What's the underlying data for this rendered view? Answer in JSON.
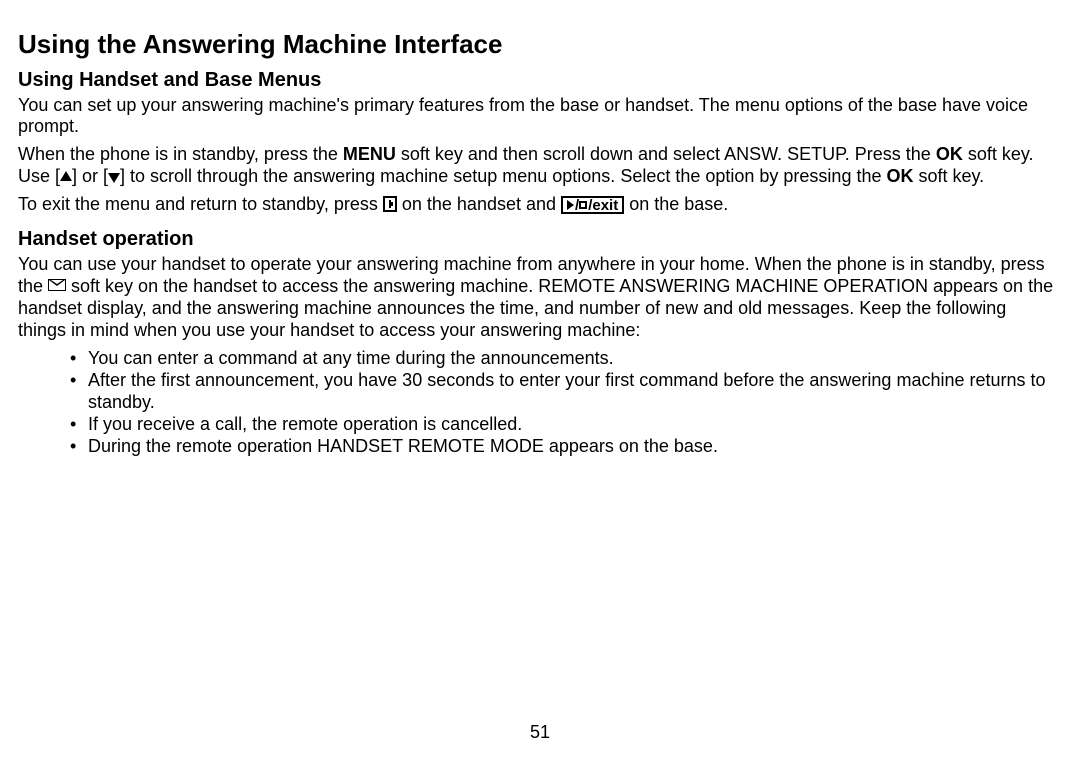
{
  "title": "Using the Answering Machine Interface",
  "section1": {
    "heading": "Using Handset and Base Menus",
    "p1": "You can set up your answering machine's primary features from the base or handset. The menu options of the base have voice prompt.",
    "p2a": "When the phone is in standby, press the ",
    "p2_menu": "MENU",
    "p2b": " soft key and then scroll down and select ANSW. SETUP. Press the ",
    "p2_ok": "OK",
    "p2c": " soft key. Use [",
    "p2_or": "] or [",
    "p2d": "] to scroll through the answering machine setup menu options. Select the option by pressing the ",
    "p2_ok2": "OK",
    "p2e": " soft key.",
    "p3a": "To exit the menu and return to standby, press ",
    "p3b": " on the handset and ",
    "p3_exit_slash": "/",
    "p3_exit_text": "exit",
    "p3c": " on the base."
  },
  "section2": {
    "heading": "Handset operation",
    "p1a": "You can use your handset to operate your answering machine from anywhere in your home. When the phone is in standby, press the ",
    "p1b": " soft key on the handset to access the answering machine. REMOTE ANSWERING MACHINE OPERATION appears on the handset display, and the answering machine announces the time, and number of new and old messages. Keep the following things in mind when you use your handset to access your answering machine:",
    "bullets": [
      "You can enter a command at any time during the announcements.",
      "After the first announcement, you have 30 seconds to enter your first command before the answering machine returns to standby.",
      "If you receive a call, the remote operation is cancelled.",
      "During the remote operation HANDSET REMOTE MODE appears on the base."
    ]
  },
  "pageNumber": "51"
}
